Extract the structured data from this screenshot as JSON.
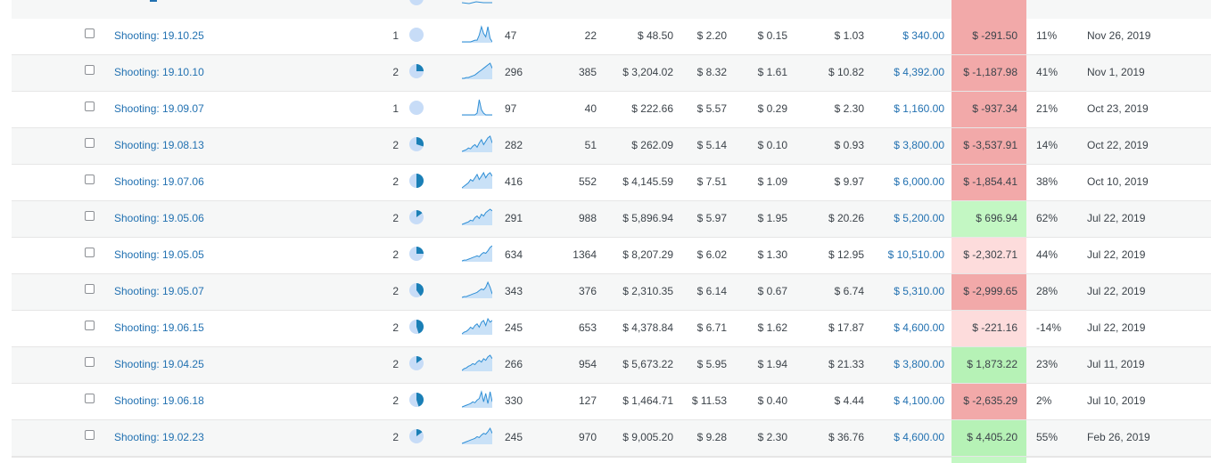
{
  "colors": {
    "link": "#2271b1",
    "pie_light": "#c7dcf7",
    "pie_dark": "#1a7fb6",
    "spark_fill": "#c9e1f7",
    "spark_stroke": "#2f8fd6",
    "profit_negative_strong": "#f2a9a9",
    "profit_negative_light": "#fddcdc",
    "profit_positive_light": "#c3f7c3",
    "profit_positive_strong": "#b6f2b6"
  },
  "rows": [
    {
      "name": "Shooting: 19.10.25",
      "count": "1",
      "pie": 0,
      "spark": [
        0,
        0,
        0,
        0,
        0,
        1,
        2,
        2,
        8,
        18,
        10,
        6,
        18,
        4,
        0
      ],
      "a": "47",
      "b": "22",
      "c": "$ 48.50",
      "d": "$ 2.20",
      "e": "$ 0.15",
      "f": "$ 1.03",
      "g": "$ 340.00",
      "h": "$ -291.50",
      "h_color": "#f2a9a9",
      "i": "11%",
      "j": "Nov 26, 2019"
    },
    {
      "name": "Shooting: 19.10.10",
      "count": "2",
      "pie": 0.25,
      "spark": [
        0,
        0,
        1,
        1,
        2,
        3,
        4,
        6,
        8,
        10,
        12,
        14,
        16,
        18,
        12
      ],
      "a": "296",
      "b": "385",
      "c": "$ 3,204.02",
      "d": "$ 8.32",
      "e": "$ 1.61",
      "f": "$ 10.82",
      "g": "$ 4,392.00",
      "h": "$ -1,187.98",
      "h_color": "#f2a9a9",
      "i": "41%",
      "j": "Nov 1, 2019"
    },
    {
      "name": "Shooting: 19.09.07",
      "count": "1",
      "pie": 0,
      "spark": [
        0,
        0,
        0,
        0,
        0,
        0,
        0,
        2,
        18,
        6,
        2,
        0,
        0,
        0,
        0
      ],
      "a": "97",
      "b": "40",
      "c": "$ 222.66",
      "d": "$ 5.57",
      "e": "$ 0.29",
      "f": "$ 2.30",
      "g": "$ 1,160.00",
      "h": "$ -937.34",
      "h_color": "#f2a9a9",
      "i": "21%",
      "j": "Oct 23, 2019"
    },
    {
      "name": "Shooting: 19.08.13",
      "count": "2",
      "pie": 0.3,
      "spark": [
        0,
        1,
        2,
        4,
        3,
        6,
        8,
        5,
        10,
        14,
        8,
        12,
        16,
        18,
        10
      ],
      "a": "282",
      "b": "51",
      "c": "$ 262.09",
      "d": "$ 5.14",
      "e": "$ 0.10",
      "f": "$ 0.93",
      "g": "$ 3,800.00",
      "h": "$ -3,537.91",
      "h_color": "#f2a9a9",
      "i": "14%",
      "j": "Oct 22, 2019"
    },
    {
      "name": "Shooting: 19.07.06",
      "count": "2",
      "pie": 0.5,
      "spark": [
        0,
        2,
        4,
        6,
        10,
        8,
        12,
        16,
        10,
        14,
        18,
        12,
        16,
        18,
        14
      ],
      "a": "416",
      "b": "552",
      "c": "$ 4,145.59",
      "d": "$ 7.51",
      "e": "$ 1.09",
      "f": "$ 9.97",
      "g": "$ 6,000.00",
      "h": "$ -1,854.41",
      "h_color": "#f2a9a9",
      "i": "38%",
      "j": "Oct 10, 2019"
    },
    {
      "name": "Shooting: 19.05.06",
      "count": "2",
      "pie": 0.15,
      "spark": [
        0,
        1,
        2,
        3,
        5,
        4,
        8,
        10,
        7,
        12,
        10,
        14,
        16,
        18,
        16
      ],
      "a": "291",
      "b": "988",
      "c": "$ 5,896.94",
      "d": "$ 5.97",
      "e": "$ 1.95",
      "f": "$ 20.26",
      "g": "$ 5,200.00",
      "h": "$ 696.94",
      "h_color": "#c3f7c3",
      "i": "62%",
      "j": "Jul 22, 2019"
    },
    {
      "name": "Shooting: 19.05.05",
      "count": "2",
      "pie": 0.25,
      "spark": [
        0,
        1,
        1,
        2,
        3,
        4,
        5,
        6,
        5,
        8,
        10,
        9,
        12,
        16,
        18
      ],
      "a": "634",
      "b": "1364",
      "c": "$ 8,207.29",
      "d": "$ 6.02",
      "e": "$ 1.30",
      "f": "$ 12.95",
      "g": "$ 10,510.00",
      "h": "$ -2,302.71",
      "h_color": "#fddcdc",
      "i": "44%",
      "j": "Jul 22, 2019"
    },
    {
      "name": "Shooting: 19.05.07",
      "count": "2",
      "pie": 0.4,
      "spark": [
        0,
        1,
        1,
        2,
        3,
        4,
        5,
        6,
        8,
        10,
        9,
        12,
        18,
        12,
        4
      ],
      "a": "343",
      "b": "376",
      "c": "$ 2,310.35",
      "d": "$ 6.14",
      "e": "$ 0.67",
      "f": "$ 6.74",
      "g": "$ 5,310.00",
      "h": "$ -2,999.65",
      "h_color": "#f2a9a9",
      "i": "28%",
      "j": "Jul 22, 2019"
    },
    {
      "name": "Shooting: 19.06.15",
      "count": "2",
      "pie": 0.45,
      "spark": [
        0,
        2,
        3,
        5,
        8,
        6,
        10,
        12,
        8,
        14,
        16,
        10,
        18,
        14,
        16
      ],
      "a": "245",
      "b": "653",
      "c": "$ 4,378.84",
      "d": "$ 6.71",
      "e": "$ 1.62",
      "f": "$ 17.87",
      "g": "$ 4,600.00",
      "h": "$ -221.16",
      "h_color": "#fddcdc",
      "i": "-14%",
      "j": "Jul 22, 2019"
    },
    {
      "name": "Shooting: 19.04.25",
      "count": "2",
      "pie": 0.15,
      "spark": [
        0,
        2,
        3,
        5,
        6,
        8,
        7,
        10,
        12,
        10,
        14,
        12,
        16,
        18,
        14
      ],
      "a": "266",
      "b": "954",
      "c": "$ 5,673.22",
      "d": "$ 5.95",
      "e": "$ 1.94",
      "f": "$ 21.33",
      "g": "$ 3,800.00",
      "h": "$ 1,873.22",
      "h_color": "#b6f2b6",
      "i": "23%",
      "j": "Jul 11, 2019"
    },
    {
      "name": "Shooting: 19.06.18",
      "count": "2",
      "pie": 0.45,
      "spark": [
        0,
        1,
        2,
        3,
        4,
        6,
        5,
        8,
        10,
        18,
        6,
        16,
        4,
        18,
        6
      ],
      "a": "330",
      "b": "127",
      "c": "$ 1,464.71",
      "d": "$ 11.53",
      "e": "$ 0.40",
      "f": "$ 4.44",
      "g": "$ 4,100.00",
      "h": "$ -2,635.29",
      "h_color": "#f2a9a9",
      "i": "2%",
      "j": "Jul 10, 2019"
    },
    {
      "name": "Shooting: 19.02.23",
      "count": "2",
      "pie": 0.15,
      "spark": [
        0,
        1,
        2,
        3,
        4,
        5,
        6,
        8,
        7,
        10,
        12,
        11,
        14,
        18,
        12
      ],
      "a": "245",
      "b": "970",
      "c": "$ 9,005.20",
      "d": "$ 9.28",
      "e": "$ 2.30",
      "f": "$ 36.76",
      "g": "$ 4,600.00",
      "h": "$ 4,405.20",
      "h_color": "#b6f2b6",
      "i": "55%",
      "j": "Feb 26, 2019"
    }
  ]
}
